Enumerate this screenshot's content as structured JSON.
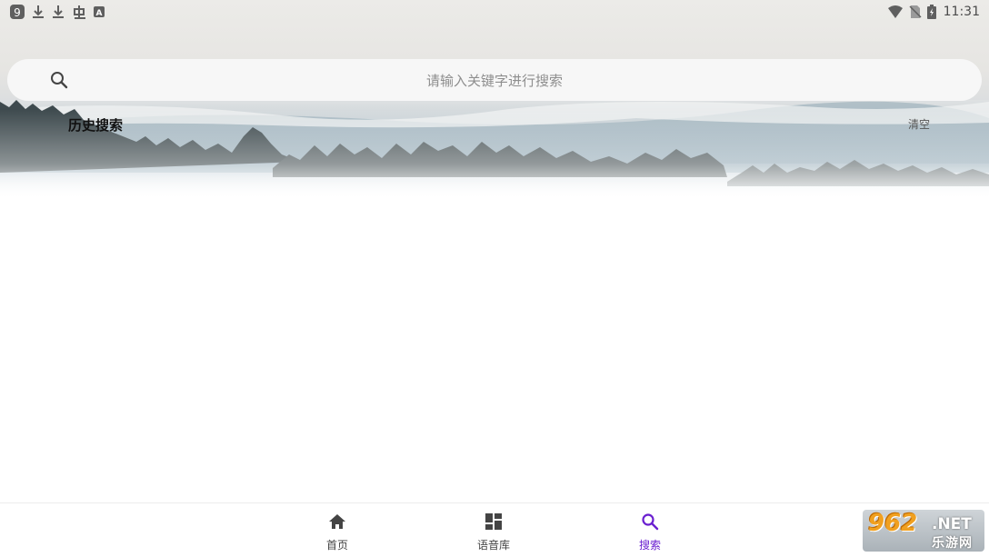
{
  "status_bar": {
    "time": "11:31",
    "left_icons": [
      "app-badge-icon",
      "download-icon",
      "download-icon",
      "bug-icon",
      "a-box-icon"
    ],
    "right_icons": [
      "wifi-icon",
      "no-sim-icon",
      "battery-icon"
    ]
  },
  "search": {
    "placeholder": "请输入关键字进行搜索",
    "value": ""
  },
  "history": {
    "title": "历史搜索",
    "clear_label": "清空",
    "items": []
  },
  "bottom_nav": {
    "items": [
      {
        "label": "首页",
        "icon": "home-icon",
        "active": false
      },
      {
        "label": "语音库",
        "icon": "grid-icon",
        "active": false
      },
      {
        "label": "搜索",
        "icon": "search-icon",
        "active": true
      }
    ]
  },
  "watermark": {
    "number": "962",
    "suffix": ".NET",
    "chinese": "乐游网"
  },
  "colors": {
    "accent": "#6a1fd0",
    "nav_text": "#444444",
    "search_bg": "#f7f7f7"
  }
}
